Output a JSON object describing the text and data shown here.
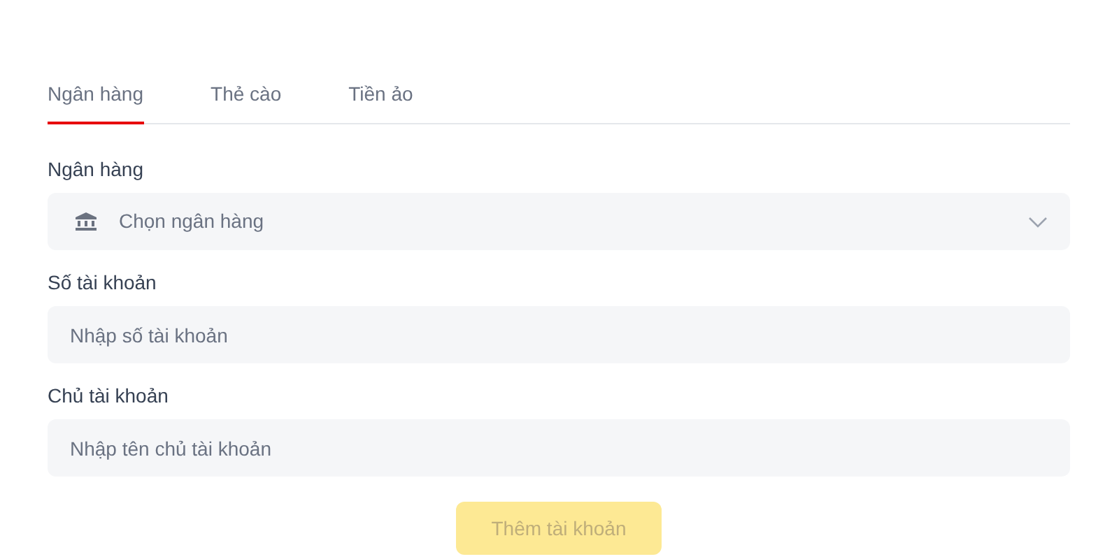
{
  "tabs": [
    {
      "label": "Ngân hàng",
      "selected": true
    },
    {
      "label": "Thẻ cào",
      "selected": false
    },
    {
      "label": "Tiền ảo",
      "selected": false
    }
  ],
  "fields": [
    {
      "kind": "select",
      "label": "Ngân hàng",
      "placeholder": "Chọn ngân hàng"
    },
    {
      "kind": "text",
      "label": "Số tài khoản",
      "placeholder": "Nhập số tài khoản"
    },
    {
      "kind": "text",
      "label": "Chủ tài khoản",
      "placeholder": "Nhập tên chủ tài khoản"
    }
  ],
  "submit": {
    "label": "Thêm tài khoản",
    "disabled": true
  }
}
